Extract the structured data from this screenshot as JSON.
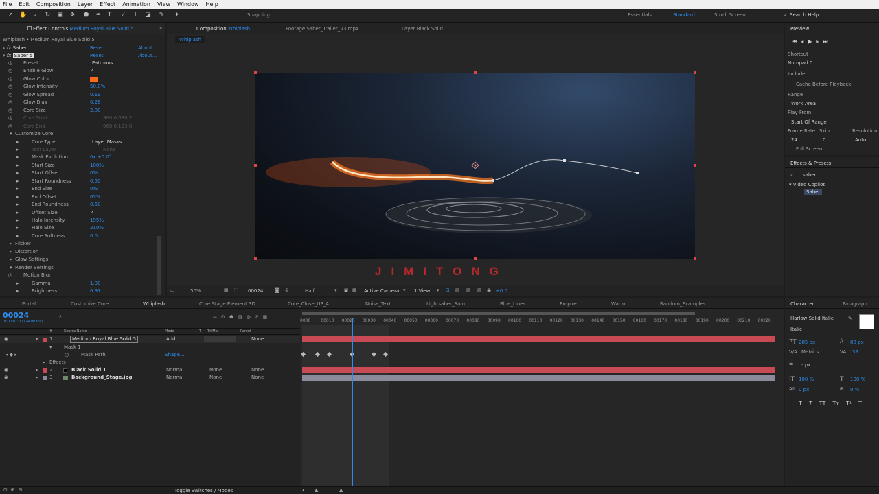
{
  "menu": [
    "File",
    "Edit",
    "Composition",
    "Layer",
    "Effect",
    "Animation",
    "View",
    "Window",
    "Help"
  ],
  "toolbar": {
    "snapping": "Snapping",
    "workspaces": [
      "Essentials",
      "Standard",
      "Small Screen"
    ],
    "search": "Search Help"
  },
  "effect_controls": {
    "tab": "Effect Controls",
    "layer": "Medium Royal Blue Solid 5",
    "breadcrumb": "Whiplash • Medium Royal Blue Solid 5",
    "effects": [
      {
        "name": "Saber",
        "reset": "Reset",
        "about": "About..."
      },
      {
        "name": "Saber 5",
        "reset": "Reset",
        "about": "About..."
      }
    ],
    "props": [
      {
        "label": "Preset",
        "value": "Patronus",
        "indent": 1
      },
      {
        "label": "Enable Glow",
        "value": "✓",
        "indent": 1
      },
      {
        "label": "Glow Color",
        "value": "",
        "indent": 1
      },
      {
        "label": "Glow Intensity",
        "value": "50.0%",
        "indent": 1
      },
      {
        "label": "Glow Spread",
        "value": "0.19",
        "indent": 1
      },
      {
        "label": "Glow Bias",
        "value": "0.26",
        "indent": 1
      },
      {
        "label": "Core Size",
        "value": "2.00",
        "indent": 1
      },
      {
        "label": "Core Start",
        "value": "960.0,690.2",
        "indent": 1
      },
      {
        "label": "Core End",
        "value": "960.0,123.8",
        "indent": 1
      },
      {
        "label": "Customize Core",
        "value": "",
        "indent": 0
      },
      {
        "label": "Core Type",
        "value": "Layer Masks",
        "indent": 2
      },
      {
        "label": "Text Layer",
        "value": "None",
        "indent": 2
      },
      {
        "label": "Mask Evolution",
        "value": "0x +0.0°",
        "indent": 2
      },
      {
        "label": "Start Size",
        "value": "100%",
        "indent": 2
      },
      {
        "label": "Start Offset",
        "value": "0%",
        "indent": 2
      },
      {
        "label": "Start Roundness",
        "value": "0.50",
        "indent": 2
      },
      {
        "label": "End Size",
        "value": "0%",
        "indent": 2
      },
      {
        "label": "End Offset",
        "value": "63%",
        "indent": 2
      },
      {
        "label": "End Roundness",
        "value": "0.50",
        "indent": 2
      },
      {
        "label": "Offset Size",
        "value": "✓",
        "indent": 2
      },
      {
        "label": "Halo Intensity",
        "value": "195%",
        "indent": 2
      },
      {
        "label": "Halo Size",
        "value": "210%",
        "indent": 2
      },
      {
        "label": "Core Softness",
        "value": "0.0",
        "indent": 2
      },
      {
        "label": "Flicker",
        "value": "",
        "indent": 0
      },
      {
        "label": "Distortion",
        "value": "",
        "indent": 0
      },
      {
        "label": "Glow Settings",
        "value": "",
        "indent": 0
      },
      {
        "label": "Render Settings",
        "value": "",
        "indent": 0
      },
      {
        "label": "Motion Blur",
        "value": "",
        "indent": 1
      },
      {
        "label": "Gamma",
        "value": "1.00",
        "indent": 2
      },
      {
        "label": "Brightness",
        "value": "0.97",
        "indent": 2
      }
    ]
  },
  "comp_tabs": [
    {
      "label": "Composition",
      "name": "Whiplash"
    },
    {
      "label": "Footage Saber_Trailer_V3.mp4"
    },
    {
      "label": "Layer Black Solid 1"
    }
  ],
  "comp_subtab": "Whiplash",
  "watermark": "JIMITONG",
  "viewer_footer": {
    "zoom": "50%",
    "frame": "00024",
    "resolution": "Half",
    "camera": "Active Camera",
    "views": "1 View",
    "exposure": "+0.0"
  },
  "preview": {
    "title": "Preview",
    "shortcut_label": "Shortcut",
    "shortcut": "Numpad 0",
    "include": "Include:",
    "cache": "Cache Before Playback",
    "range_label": "Range",
    "range": "Work Area",
    "play_from_label": "Play From",
    "play_from": "Start Of Range",
    "frame_rate_label": "Frame Rate",
    "skip_label": "Skip",
    "resolution_label": "Resolution",
    "frame_rate": "24",
    "skip": "0",
    "resolution": "Auto",
    "full_screen": "Full Screen"
  },
  "effects_presets": {
    "title": "Effects & Presets",
    "search": "saber",
    "folder": "Video Copilot",
    "item": "Saber"
  },
  "timeline_tabs": [
    "Portal",
    "Customize Core",
    "Whiplash",
    "Core Stage Element 3D",
    "Core_Close_UP_A",
    "Noise_Text",
    "Lightsaber_Sam",
    "Blue_Lines",
    "Empire",
    "Warm",
    "Random_Examples"
  ],
  "timeline": {
    "timecode": "00024",
    "fps": "0:00:01:00 (24.00 fps)",
    "headers": {
      "num": "#",
      "source": "Source Name",
      "mode": "Mode",
      "t": "T",
      "trkmat": "TrkMat",
      "parent": "Parent"
    },
    "layers": [
      {
        "num": "1",
        "name": "Medium Royal Blue Solid 5",
        "mode": "Add",
        "trkmat": "",
        "parent": "None",
        "color": "#c74a55"
      },
      {
        "num": "2",
        "name": "Black Solid 1",
        "mode": "Normal",
        "trkmat": "None",
        "parent": "None",
        "color": "#c74a55"
      },
      {
        "num": "3",
        "name": "Background_Stage.jpg",
        "mode": "Normal",
        "trkmat": "None",
        "parent": "None",
        "color": "#8a8a9a"
      }
    ],
    "mask": "Mask 1",
    "mask_path": "Mask Path",
    "shape": "Shape...",
    "effects": "Effects",
    "ticks": [
      "0000",
      "00010",
      "00020",
      "00030",
      "00040",
      "00050",
      "00060",
      "00070",
      "00080",
      "00090",
      "00100",
      "00110",
      "00120",
      "00130",
      "00140",
      "00150",
      "00160",
      "00170",
      "00180",
      "00190",
      "00200",
      "00210",
      "00220"
    ],
    "footer": "Toggle Switches / Modes"
  },
  "character": {
    "title": "Character",
    "tab2": "Paragraph",
    "font": "Harlow Solid Italic",
    "style": "Italic",
    "size": "285 px",
    "leading": "88 px",
    "kerning": "Metrics",
    "tracking": "39",
    "stroke": "- px",
    "vscale": "100 %",
    "hscale": "100 %",
    "baseline": "0 px",
    "tsume": "0 %",
    "styles": [
      "T",
      "T",
      "TT",
      "Tт",
      "T¹",
      "T₁"
    ]
  }
}
